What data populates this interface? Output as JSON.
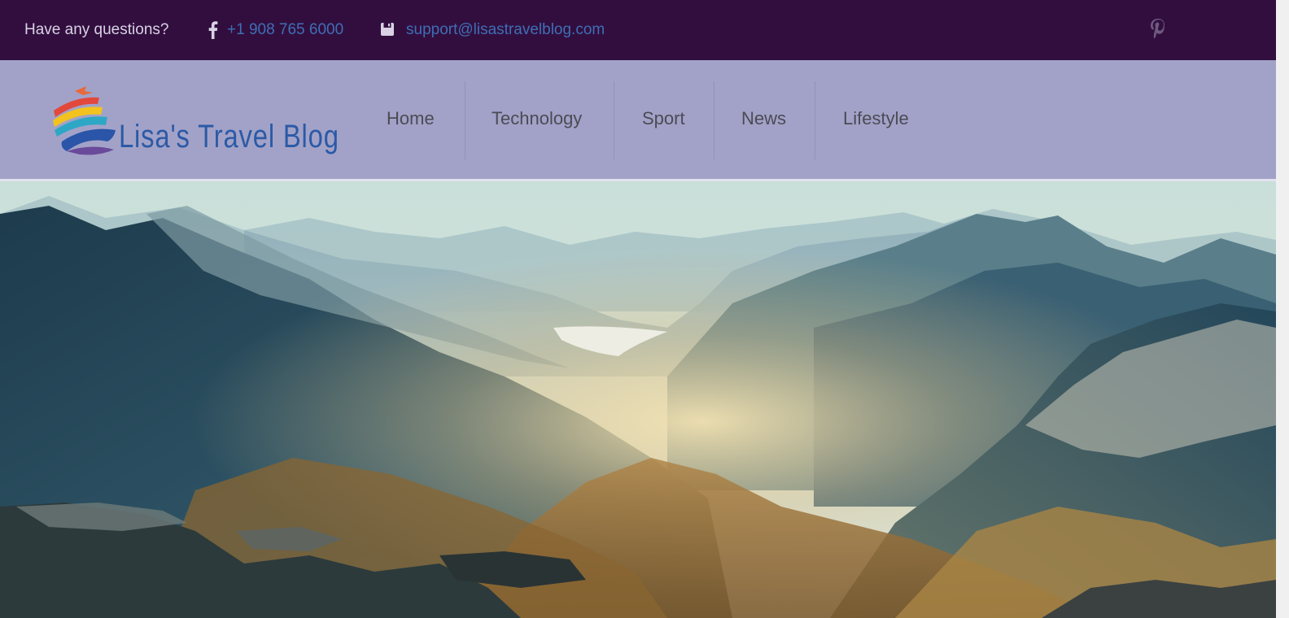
{
  "topbar": {
    "question": "Have any questions?",
    "phone": "+1 908 765 6000",
    "email": "support@lisastravelblog.com",
    "facebook_icon": "facebook-icon",
    "email_icon": "email-icon",
    "pinterest_icon": "pinterest-icon",
    "bg_color": "#320e3f",
    "link_color": "#3e6fb4"
  },
  "header": {
    "logo_text": "Lisa's Travel Blog",
    "bg_color": "#a2a2c8"
  },
  "nav": {
    "items": [
      {
        "label": "Home"
      },
      {
        "label": "Technology"
      },
      {
        "label": "Sport"
      },
      {
        "label": "News"
      },
      {
        "label": "Lifestyle"
      }
    ]
  },
  "hero": {
    "image": "mountain-valley-landscape"
  }
}
